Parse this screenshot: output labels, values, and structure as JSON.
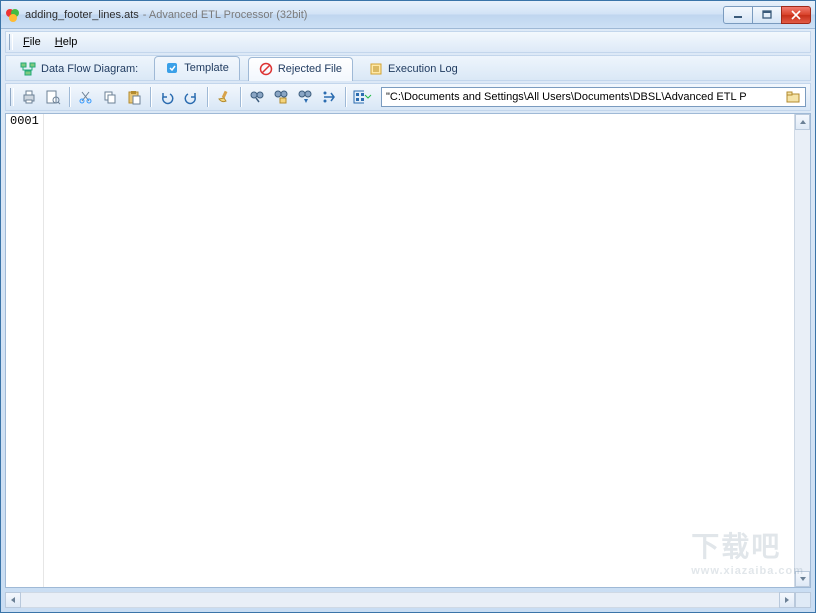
{
  "window": {
    "title_file": "adding_footer_lines.ats",
    "title_app": "- Advanced ETL Processor (32bit)"
  },
  "menu": {
    "file": "File",
    "help": "Help"
  },
  "tabs": {
    "label": "Data Flow Diagram:",
    "template": "Template",
    "rejected": "Rejected File",
    "log": "Execution Log"
  },
  "toolbar": {
    "path": "\"C:\\Documents and Settings\\All Users\\Documents\\DBSL\\Advanced ETL P"
  },
  "editor": {
    "line1": "0001"
  },
  "watermark": {
    "main": "下载吧",
    "sub": "www.xiazaiba.com"
  }
}
